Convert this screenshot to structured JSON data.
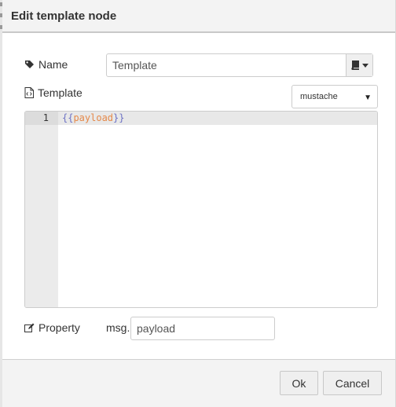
{
  "dialog": {
    "title": "Edit template node"
  },
  "fields": {
    "name": {
      "label": "Name",
      "value": "Template",
      "icon": "tag-icon",
      "lib_icon": "book-icon"
    },
    "template": {
      "label": "Template",
      "icon": "file-code-icon",
      "format": {
        "selected": "mustache"
      },
      "editor": {
        "lines": [
          {
            "number": "1",
            "open": "{{",
            "var": "payload",
            "close": "}}"
          }
        ]
      }
    },
    "property": {
      "label": "Property",
      "icon": "edit-icon",
      "prefix": "msg.",
      "value": "payload"
    }
  },
  "footer": {
    "ok_label": "Ok",
    "cancel_label": "Cancel"
  },
  "colors": {
    "titlebar_bg": "#f3f3f3",
    "gutter_bg": "#ebebeb",
    "code_brace": "#6c71c4",
    "code_var": "#e5894a"
  }
}
